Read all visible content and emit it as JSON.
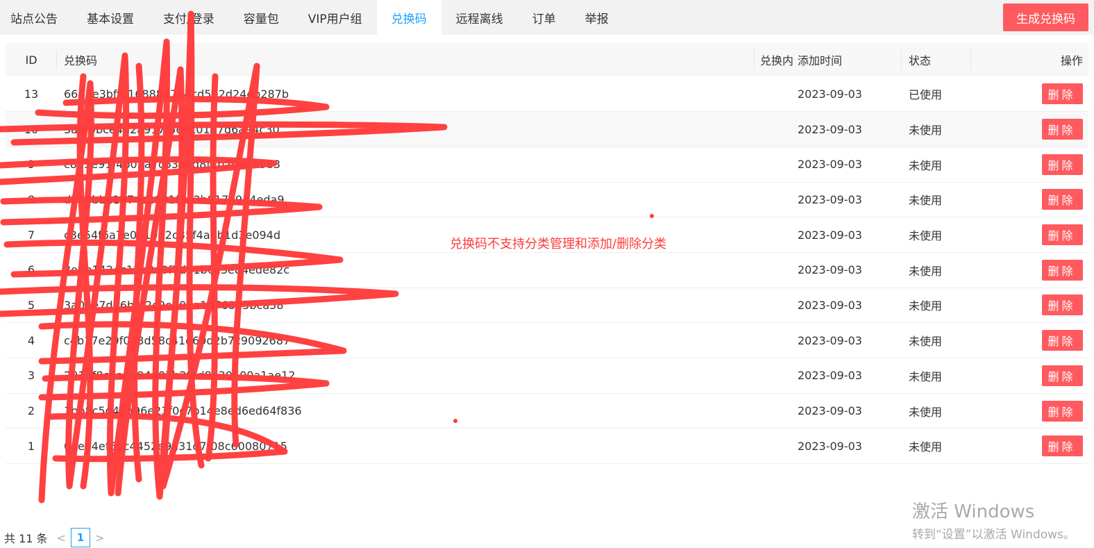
{
  "tabs": [
    {
      "label": "站点公告",
      "active": false
    },
    {
      "label": "基本设置",
      "active": false
    },
    {
      "label": "支付/登录",
      "active": false
    },
    {
      "label": "容量包",
      "active": false
    },
    {
      "label": "VIP用户组",
      "active": false
    },
    {
      "label": "兑换码",
      "active": true
    },
    {
      "label": "远程离线",
      "active": false
    },
    {
      "label": "订单",
      "active": false
    },
    {
      "label": "举报",
      "active": false
    }
  ],
  "actions": {
    "generate_label": "生成兑换码"
  },
  "table": {
    "headers": {
      "id": "ID",
      "code": "兑换码",
      "content": "兑换内",
      "added": "添加时间",
      "status": "状态",
      "op": "操作"
    },
    "delete_label": "删除",
    "rows": [
      {
        "id": "13",
        "code": "6643e3bffb1688847a4cd502d24eb287b",
        "content": "",
        "added": "2023-09-03",
        "status": "已使用"
      },
      {
        "id": "10",
        "code": "3a6f0bce4d2a917f5e8c01b7d6a94c30",
        "content": "",
        "added": "2023-09-03",
        "status": "未使用"
      },
      {
        "id": "9",
        "code": "c8d5e91f4b02a7c63e5d8f1b20a4e983",
        "content": "",
        "added": "2023-09-03",
        "status": "未使用"
      },
      {
        "id": "8",
        "code": "d2a9bbe1074c2601f5e3b817a9d4eda9",
        "content": "",
        "added": "2023-09-03",
        "status": "未使用"
      },
      {
        "id": "7",
        "code": "c3e54f6a7e0b19d2c85f4a6b1d3e094d",
        "content": "",
        "added": "2023-09-03",
        "status": "未使用"
      },
      {
        "id": "6",
        "code": "3e8b1424c12e9a0f7d51b6c3e84ede82c",
        "content": "",
        "added": "2023-09-03",
        "status": "未使用"
      },
      {
        "id": "5",
        "code": "3a06e7d16b4f2c9e805a1d763b5bca58",
        "content": "",
        "added": "2023-09-03",
        "status": "未使用"
      },
      {
        "id": "4",
        "code": "c4b17e29f0a3d58c41e69d2b7c9092687",
        "content": "",
        "added": "2023-09-03",
        "status": "未使用"
      },
      {
        "id": "3",
        "code": "2013f8c5a6e94d07b2f1d8e30600a1ae12",
        "content": "",
        "added": "2023-09-03",
        "status": "未使用"
      },
      {
        "id": "2",
        "code": "1bb8c5d48a96e23f0c7b14e8ed6ed64f836",
        "content": "",
        "added": "2023-09-03",
        "status": "未使用"
      },
      {
        "id": "1",
        "code": "0eea4ef6bc4452e9a31d7f08c60080715",
        "content": "",
        "added": "2023-09-03",
        "status": "未使用"
      }
    ]
  },
  "annotation": {
    "text": "兑换码不支持分类管理和添加/删除分类",
    "color": "#ff3b3b"
  },
  "pagination": {
    "total_text": "共 11 条",
    "prev": "<",
    "next": ">",
    "current_page": "1"
  },
  "watermark": {
    "line1": "激活 Windows",
    "line2": "转到“设置”以激活 Windows。"
  },
  "colors": {
    "accent": "#1e9fff",
    "danger": "#ff5a5f",
    "tabbar": "#f2f2f2"
  }
}
